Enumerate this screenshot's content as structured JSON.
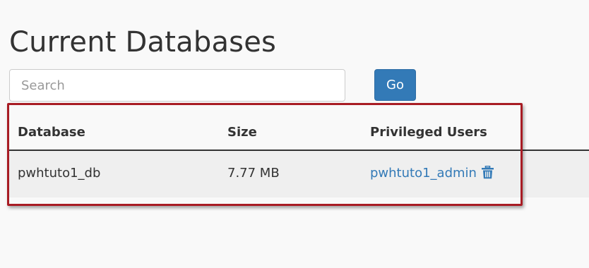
{
  "page": {
    "title": "Current Databases"
  },
  "search": {
    "placeholder": "Search",
    "value": "",
    "go_label": "Go"
  },
  "table": {
    "columns": [
      "Database",
      "Size",
      "Privileged Users"
    ],
    "rows": [
      {
        "database": "pwhtuto1_db",
        "size": "7.77 MB",
        "privileged_user": "pwhtuto1_admin",
        "action_icon": "trash-icon"
      }
    ]
  },
  "colors": {
    "accent": "#337ab7",
    "highlight": "#a81c24",
    "row_background": "#efefef"
  }
}
